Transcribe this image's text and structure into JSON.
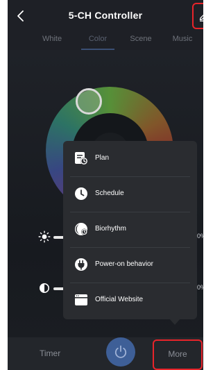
{
  "header": {
    "title": "5-CH Controller",
    "back_icon": "chevron-left-icon",
    "edit_icon": "pencil-icon"
  },
  "tabs": [
    {
      "label": "White",
      "active": false
    },
    {
      "label": "Color",
      "active": true
    },
    {
      "label": "Scene",
      "active": false
    },
    {
      "label": "Music",
      "active": false
    }
  ],
  "sliders": {
    "brightness": {
      "icon": "sun-icon",
      "value_text": "0%"
    },
    "contrast": {
      "icon": "contrast-icon",
      "value_text": "0%"
    }
  },
  "menu": {
    "items": [
      {
        "label": "Plan",
        "icon": "calendar-clock-icon"
      },
      {
        "label": "Schedule",
        "icon": "clock-icon"
      },
      {
        "label": "Biorhythm",
        "icon": "biorhythm-icon"
      },
      {
        "label": "Power-on behavior",
        "icon": "power-plug-icon"
      },
      {
        "label": "Official Website",
        "icon": "browser-window-icon"
      }
    ]
  },
  "bottom": {
    "timer_label": "Timer",
    "more_label": "More",
    "power_icon": "power-icon"
  },
  "colors": {
    "background": "#1e2026",
    "accent": "#3e5f97",
    "highlight_outline": "#e8242a",
    "menu_background": "#2a2c30"
  }
}
